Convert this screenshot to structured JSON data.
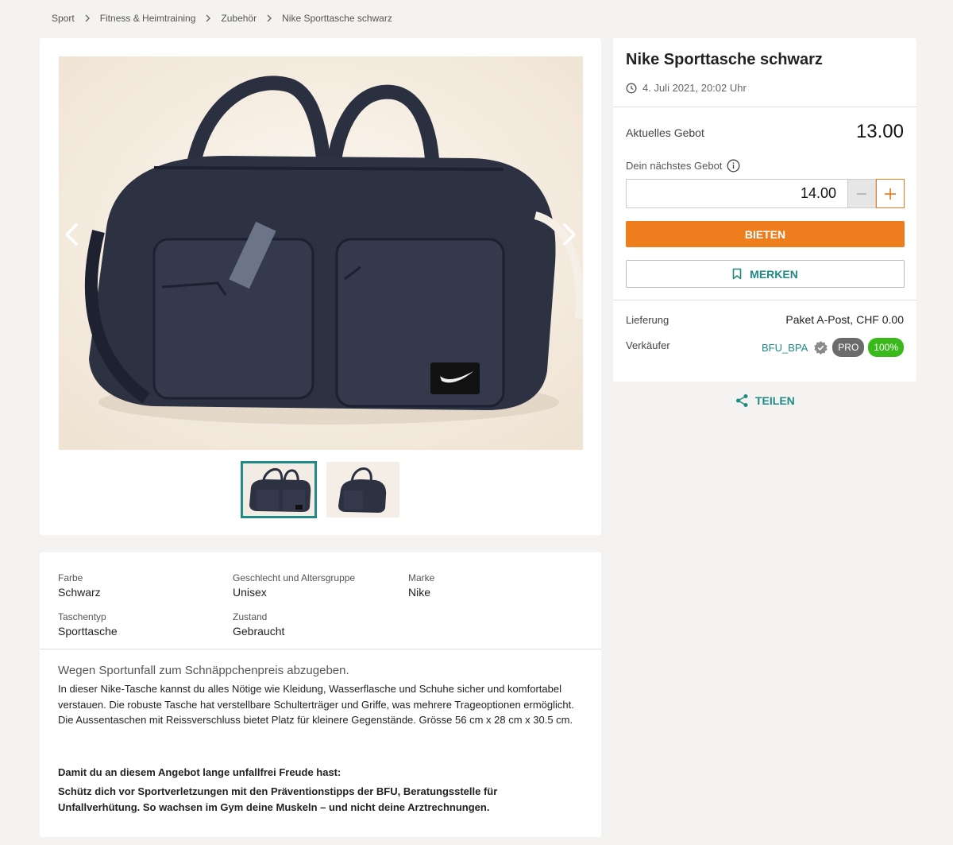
{
  "breadcrumb": {
    "items": [
      "Sport",
      "Fitness & Heimtraining",
      "Zubehör"
    ],
    "current": "Nike Sporttasche schwarz"
  },
  "listing": {
    "title": "Nike Sporttasche schwarz",
    "date": "4. Juli 2021, 20:02 Uhr",
    "current_bid_label": "Aktuelles Gebot",
    "current_bid": "13.00",
    "next_bid_label": "Dein nächstes Gebot",
    "next_bid_value": "14.00",
    "bid_button": "BIETEN",
    "watch_button": "MERKEN",
    "delivery_label": "Lieferung",
    "delivery_value": "Paket A-Post, CHF 0.00",
    "seller_label": "Verkäufer",
    "seller_name": "BFU_BPA",
    "seller_badge": "PRO",
    "seller_rating": "100%",
    "share_label": "TEILEN"
  },
  "colors": {
    "accent": "#ee7d1d",
    "teal": "#1f8a86",
    "rating_green": "#3ab91b"
  },
  "gallery": {
    "thumbnail_count": 2,
    "active_index": 0
  },
  "attributes": [
    {
      "label": "Farbe",
      "value": "Schwarz"
    },
    {
      "label": "Geschlecht und Altersgruppe",
      "value": "Unisex"
    },
    {
      "label": "Marke",
      "value": "Nike"
    },
    {
      "label": "Taschentyp",
      "value": "Sporttasche"
    },
    {
      "label": "Zustand",
      "value": "Gebraucht"
    }
  ],
  "description": {
    "headline": "Wegen Sportunfall zum Schnäppchenpreis abzugeben.",
    "paragraph1": "In dieser Nike-Tasche kannst du alles Nötige wie Kleidung, Wasserflasche und Schuhe sicher und komfortabel verstauen. Die robuste Tasche hat verstellbare Schulterträger und Griffe, was mehrere Trageoptionen ermöglicht. Die Aussentaschen mit Reissverschluss bietet Platz für kleinere Gegenstände. Grösse 56 cm x 28 cm x 30.5 cm.",
    "paragraph2": "Damit du an diesem Angebot lange unfallfrei Freude hast:",
    "paragraph3": "Schütz dich vor Sportverletzungen mit den Präventionstipps der BFU, Beratungsstelle für Unfallverhütung. So wachsen im Gym deine Muskeln – und nicht deine Arztrechnungen."
  }
}
